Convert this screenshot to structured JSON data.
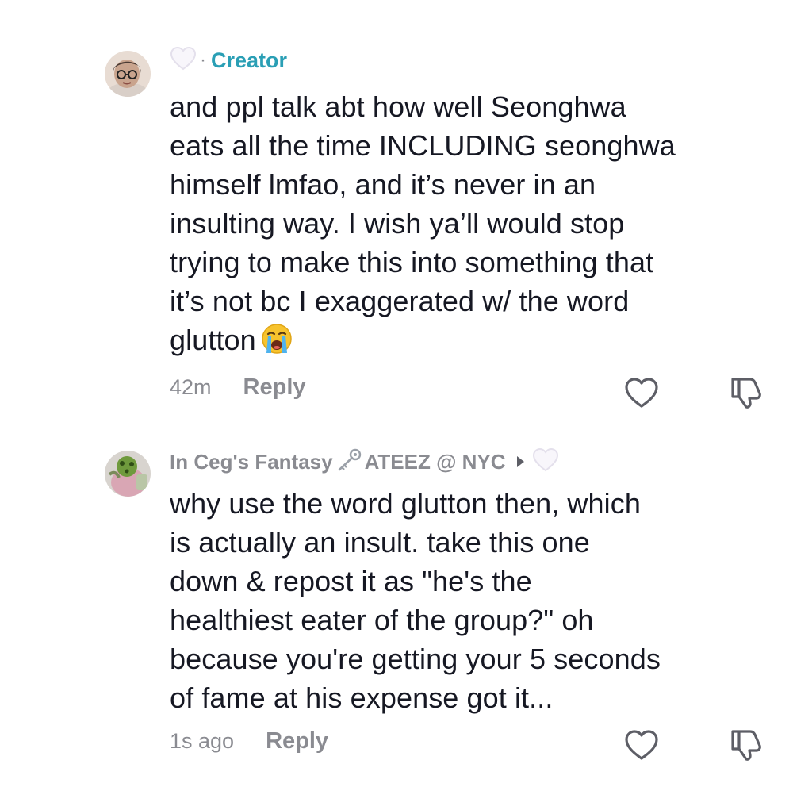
{
  "comments": [
    {
      "creator_badge": "Creator",
      "text": "and ppl talk abt how well Seonghwa\neats all the time INCLUDING seonghwa\nhimself lmfao, and it’s never in an\ninsulting way. I wish ya’ll would stop\ntrying to make this into something that\nit’s not bc I exaggerated w/ the word\nglutton",
      "emoji": "loudly-crying-face",
      "timestamp": "42m",
      "reply_label": "Reply"
    },
    {
      "username": "In Ceg's Fantasy",
      "username_suffix": "ATEEZ @ NYC",
      "text": "why use the word glutton then, which\nis actually an insult. take this one\ndown & repost it as \"he's the\nhealthiest eater of the group?\" oh\nbecause you're getting your 5 seconds\nof fame at his expense got it...",
      "timestamp": "1s ago",
      "reply_label": "Reply"
    }
  ],
  "icons": {
    "heart_badge": "white-heart-icon",
    "key": "key-icon",
    "play": "play-triangle-icon",
    "like": "heart-outline-icon",
    "dislike": "thumbs-down-icon"
  },
  "colors": {
    "creator": "#2a9fb5",
    "secondary_text": "#8a8b91",
    "primary_text": "#161823"
  }
}
